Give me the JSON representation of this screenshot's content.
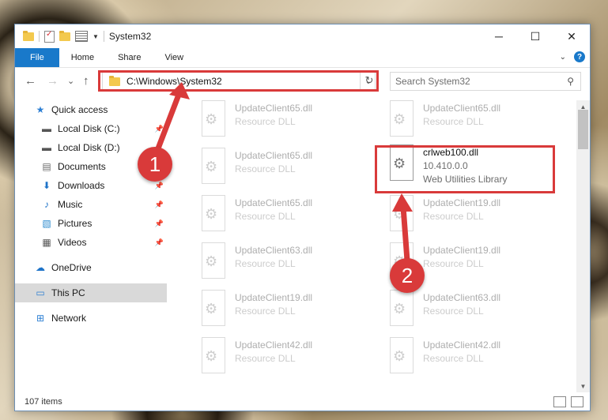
{
  "window": {
    "title": "System32"
  },
  "controls": {
    "minimize": "─",
    "maximize": "☐",
    "close": "✕"
  },
  "ribbon": {
    "tabs": [
      "File",
      "Home",
      "Share",
      "View"
    ],
    "expand": "⌄",
    "help": "?"
  },
  "nav": {
    "back": "←",
    "forward": "→",
    "recent": "⌄",
    "up": "↑"
  },
  "address": {
    "path": "C:\\Windows\\System32",
    "dropdown": "⌄",
    "refresh": "↻"
  },
  "search": {
    "placeholder": "Search System32",
    "icon": "⚲"
  },
  "sidebar": {
    "items": [
      {
        "label": "Quick access",
        "icon": "★",
        "icon_color": "#2d7fd3",
        "pinned": false
      },
      {
        "label": "Local Disk (C:)",
        "icon": "▬",
        "icon_color": "#555555",
        "pinned": true
      },
      {
        "label": "Local Disk (D:)",
        "icon": "▬",
        "icon_color": "#555555",
        "pinned": false
      },
      {
        "label": "Documents",
        "icon": "▤",
        "icon_color": "#6a6a6a",
        "pinned": true
      },
      {
        "label": "Downloads",
        "icon": "⬇",
        "icon_color": "#1e73c8",
        "pinned": true
      },
      {
        "label": "Music",
        "icon": "♪",
        "icon_color": "#1e73c8",
        "pinned": true
      },
      {
        "label": "Pictures",
        "icon": "▧",
        "icon_color": "#2f8ccf",
        "pinned": true
      },
      {
        "label": "Videos",
        "icon": "▦",
        "icon_color": "#555555",
        "pinned": true
      },
      {
        "label": "OneDrive",
        "icon": "☁",
        "icon_color": "#1e73c8",
        "pinned": false
      },
      {
        "label": "This PC",
        "icon": "▭",
        "icon_color": "#2d7fd3",
        "pinned": false,
        "selected": true
      },
      {
        "label": "Network",
        "icon": "⊞",
        "icon_color": "#2d7fd3",
        "pinned": false
      }
    ],
    "pin_glyph": "📌"
  },
  "files": [
    {
      "name": "UpdateClient65.dll",
      "sub": "Resource DLL",
      "faded": true
    },
    {
      "name": "UpdateClient65.dll",
      "sub": "Resource DLL",
      "faded": true
    },
    {
      "name": "UpdateClient65.dll",
      "sub": "Resource DLL",
      "faded": true
    },
    {
      "name": "crlweb100.dll",
      "sub": "10.410.0.0",
      "sub2": "Web Utilities Library",
      "faded": false
    },
    {
      "name": "UpdateClient65.dll",
      "sub": "Resource DLL",
      "faded": true
    },
    {
      "name": "UpdateClient19.dll",
      "sub": "Resource DLL",
      "faded": true
    },
    {
      "name": "UpdateClient63.dll",
      "sub": "Resource DLL",
      "faded": true
    },
    {
      "name": "UpdateClient19.dll",
      "sub": "Resource DLL",
      "faded": true
    },
    {
      "name": "UpdateClient19.dll",
      "sub": "Resource DLL",
      "faded": true
    },
    {
      "name": "UpdateClient63.dll",
      "sub": "Resource DLL",
      "faded": true
    },
    {
      "name": "UpdateClient42.dll",
      "sub": "Resource DLL",
      "faded": true
    },
    {
      "name": "UpdateClient42.dll",
      "sub": "Resource DLL",
      "faded": true
    }
  ],
  "status": {
    "items": "107 items"
  },
  "annotations": {
    "step1": "1",
    "step2": "2",
    "color": "#d93a3a"
  }
}
